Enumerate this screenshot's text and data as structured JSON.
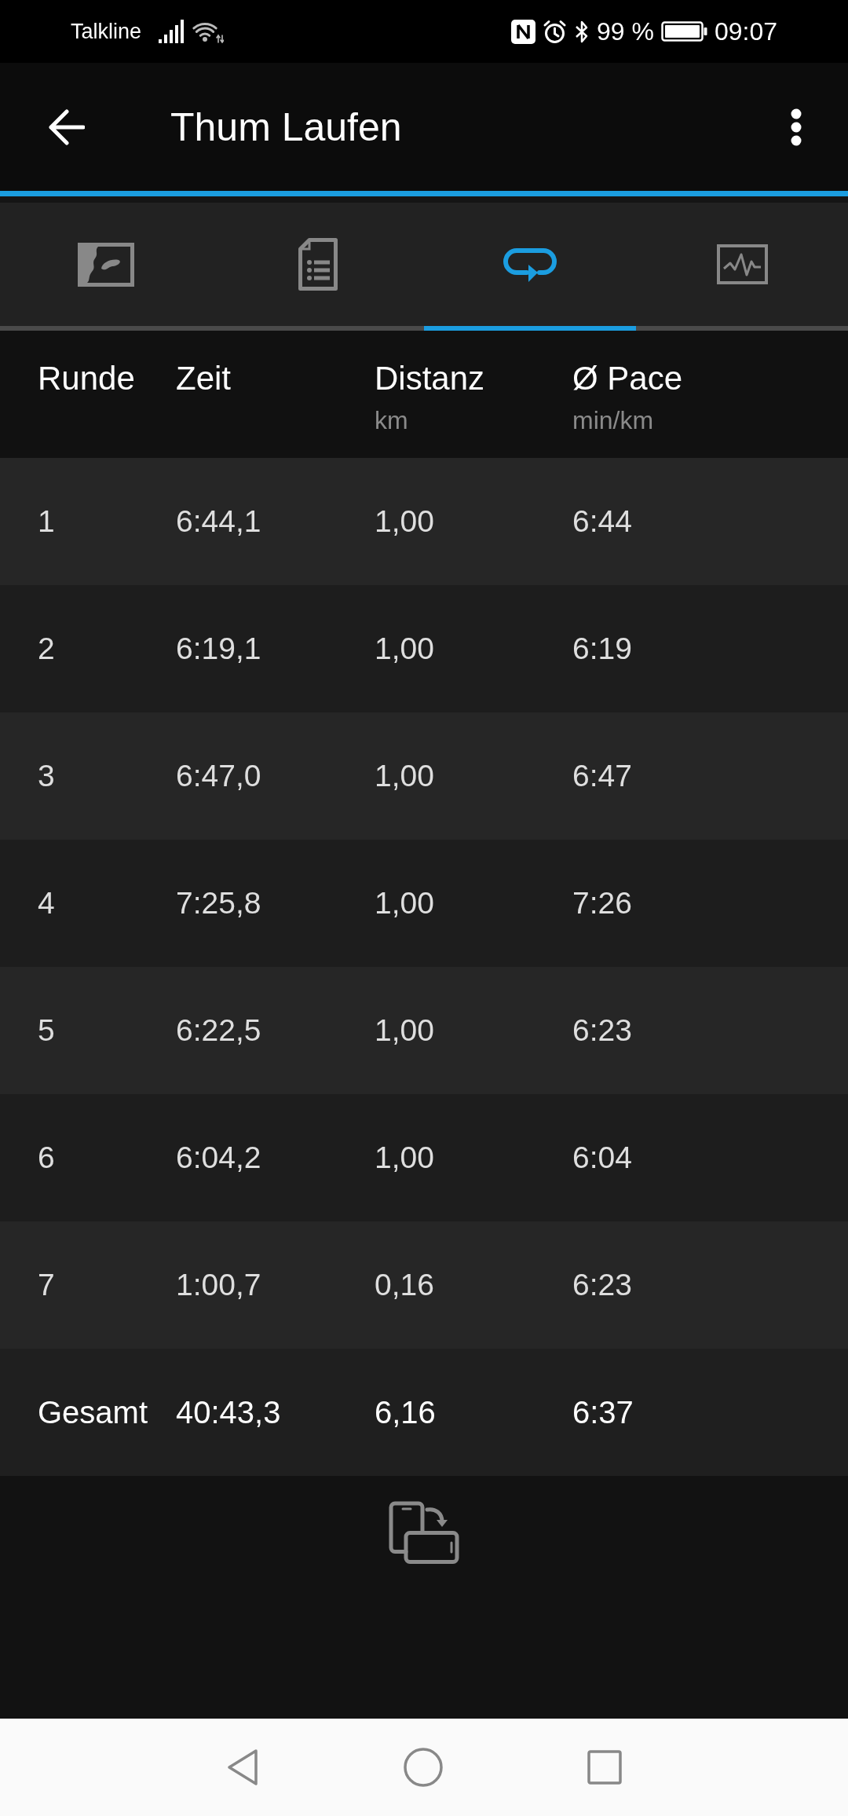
{
  "status_bar": {
    "carrier": "Talkline",
    "battery_text": "99 %",
    "time": "09:07"
  },
  "app_bar": {
    "title": "Thum Laufen"
  },
  "tabs": [
    {
      "selected": false
    },
    {
      "selected": false
    },
    {
      "selected": true
    },
    {
      "selected": false
    }
  ],
  "table": {
    "columns": [
      {
        "label": "Runde"
      },
      {
        "label": "Zeit"
      },
      {
        "label": "Distanz",
        "unit": "km"
      },
      {
        "label": "Ø Pace",
        "unit": "min/km"
      }
    ],
    "rows": [
      [
        "1",
        "6:44,1",
        "1,00",
        "6:44"
      ],
      [
        "2",
        "6:19,1",
        "1,00",
        "6:19"
      ],
      [
        "3",
        "6:47,0",
        "1,00",
        "6:47"
      ],
      [
        "4",
        "7:25,8",
        "1,00",
        "7:26"
      ],
      [
        "5",
        "6:22,5",
        "1,00",
        "6:23"
      ],
      [
        "6",
        "6:04,2",
        "1,00",
        "6:04"
      ],
      [
        "7",
        "1:00,7",
        "0,16",
        "6:23"
      ]
    ],
    "total": [
      "Gesamt",
      "40:43,3",
      "6,16",
      "6:37"
    ]
  }
}
